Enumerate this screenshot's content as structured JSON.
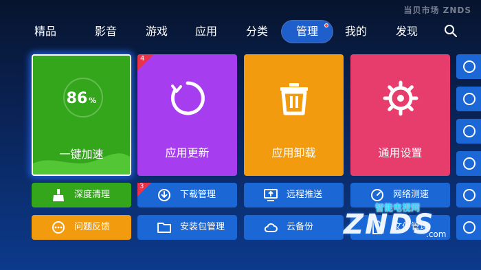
{
  "brand": {
    "text": "当贝市场 ZNDS"
  },
  "nav": [
    {
      "label": "精品"
    },
    {
      "label": "影音"
    },
    {
      "label": "游戏"
    },
    {
      "label": "应用"
    },
    {
      "label": "分类"
    },
    {
      "label": "管理",
      "active": true,
      "has_dot": true
    },
    {
      "label": "我的"
    },
    {
      "label": "发现"
    }
  ],
  "tiles": {
    "speedup": {
      "percent": "86",
      "percent_unit": "%",
      "label": "一键加速",
      "color": "#33a61b"
    },
    "update": {
      "label": "应用更新",
      "badge": "4",
      "color": "#a63ef0"
    },
    "uninstall": {
      "label": "应用卸载",
      "color": "#f39b0e"
    },
    "settings": {
      "label": "通用设置",
      "color": "#e63d6c"
    }
  },
  "buttons": {
    "deep_clean": {
      "label": "深度清理"
    },
    "feedback": {
      "label": "问题反馈"
    },
    "download": {
      "label": "下载管理",
      "badge": "3"
    },
    "package": {
      "label": "安装包管理"
    },
    "remote_push": {
      "label": "远程推送"
    },
    "cloud_backup": {
      "label": "云备份"
    },
    "net_speed": {
      "label": "网络测速"
    },
    "file_manager": {
      "label": "文件管理"
    }
  },
  "watermark": {
    "cn": "智能电视网",
    "en": "ZNDS",
    "com": ".com"
  },
  "colors": {
    "accent": "#1b67d6",
    "badge": "#e8344b"
  }
}
